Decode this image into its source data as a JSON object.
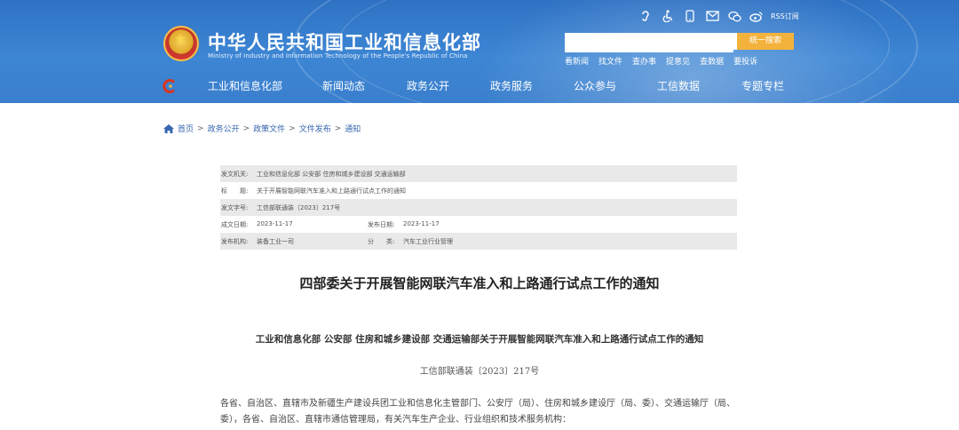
{
  "header": {
    "site_title": "中华人民共和国工业和信息化部",
    "site_subtitle": "Ministry of Industry and Information Technology of the People's Republic of China",
    "rss_label": "RSS订阅",
    "search": {
      "placeholder": "",
      "button_label": "统一搜索"
    },
    "quick_links": [
      "看新闻",
      "找文件",
      "查办事",
      "提意见",
      "查数据",
      "要投诉"
    ],
    "nav": [
      "工业和信息化部",
      "新闻动态",
      "政务公开",
      "政务服务",
      "公众参与",
      "工信数据",
      "专题专栏"
    ],
    "colors": {
      "banner": "#3a7fcd",
      "search_button": "#f3b23c"
    }
  },
  "breadcrumb": [
    "首页",
    "政务公开",
    "政策文件",
    "文件发布",
    "通知"
  ],
  "meta": {
    "issuer_key": "发文机关:",
    "issuer": "工业和信息化部 公安部 住房和城乡建设部 交通运输部",
    "title_key": "标　　题:",
    "title": "关于开展智能网联汽车准入和上路通行试点工作的通知",
    "docno_key": "发文字号:",
    "docno": "工信部联通装〔2023〕217号",
    "created_key": "成文日期:",
    "created": "2023-11-17",
    "published_key": "发布日期:",
    "published": "2023-11-17",
    "org_key": "发布机构:",
    "org": "装备工业一司",
    "category_key": "分　　类:",
    "category": "汽车工业行业管理"
  },
  "article": {
    "title": "四部委关于开展智能网联汽车准入和上路通行试点工作的通知",
    "subtitle": "工业和信息化部 公安部 住房和城乡建设部 交通运输部关于开展智能网联汽车准入和上路通行试点工作的通知",
    "docno": "工信部联通装〔2023〕217号",
    "para1": "各省、自治区、直辖市及新疆生产建设兵团工业和信息化主管部门、公安厅（局）、住房和城乡建设厅（局、委）、交通运输厅（局、委），各省、自治区、直辖市通信管理局，有关汽车生产企业、行业组织和技术服务机构："
  }
}
